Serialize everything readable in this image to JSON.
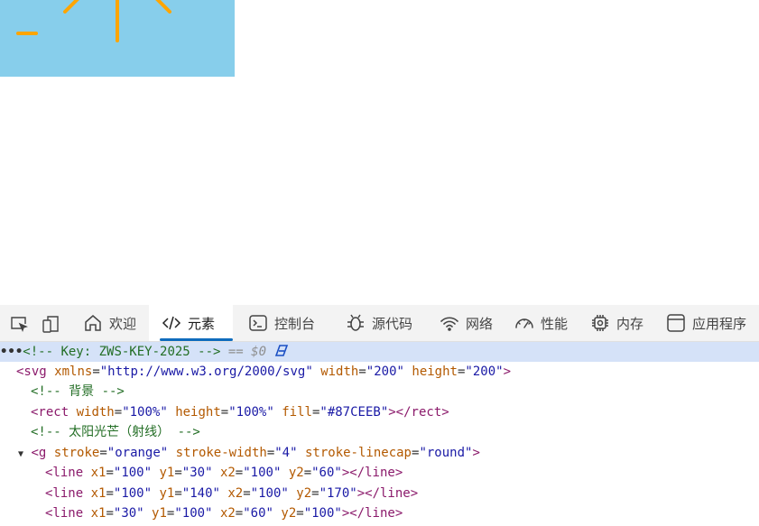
{
  "preview": {
    "background": "#87CEEB",
    "ray_color": "orange"
  },
  "devtools": {
    "tabs": [
      {
        "label": "欢迎",
        "icon": "home-icon"
      },
      {
        "label": "元素",
        "icon": "code-brackets-icon",
        "active": true
      },
      {
        "label": "控制台",
        "icon": "console-icon"
      },
      {
        "label": "源代码",
        "icon": "bug-icon"
      },
      {
        "label": "网络",
        "icon": "wifi-icon"
      },
      {
        "label": "性能",
        "icon": "gauge-icon"
      },
      {
        "label": "内存",
        "icon": "chip-icon"
      },
      {
        "label": "应用程序",
        "icon": "app-window-icon"
      }
    ],
    "code": {
      "l1_ellipsis": "•••",
      "l1_comment": "<!-- Key: ZWS-KEY-2025 -->",
      "l1_eq": " == $0",
      "l2_open": "<svg",
      "l2_a1": "xmlns",
      "l2_v1": "\"http://www.w3.org/2000/svg\"",
      "l2_a2": "width",
      "l2_v2": "\"200\"",
      "l2_a3": "height",
      "l2_v3": "\"200\"",
      "l2_close": ">",
      "l3_comment": "<!-- 背景 -->",
      "l4_open": "<rect",
      "l4_a1": "width",
      "l4_v1": "\"100%\"",
      "l4_a2": "height",
      "l4_v2": "\"100%\"",
      "l4_a3": "fill",
      "l4_v3": "\"#87CEEB\"",
      "l4_close": "></rect>",
      "l5_comment": "<!-- 太阳光芒（射线） -->",
      "l6_triangle": "▼",
      "l6_open": "<g",
      "l6_a1": "stroke",
      "l6_v1": "\"orange\"",
      "l6_a2": "stroke-width",
      "l6_v2": "\"4\"",
      "l6_a3": "stroke-linecap",
      "l6_v3": "\"round\"",
      "l6_close": ">",
      "lines": [
        {
          "x1": "\"100\"",
          "y1": "\"30\"",
          "x2": "\"100\"",
          "y2": "\"60\""
        },
        {
          "x1": "\"100\"",
          "y1": "\"140\"",
          "x2": "\"100\"",
          "y2": "\"170\""
        },
        {
          "x1": "\"30\"",
          "y1": "\"100\"",
          "x2": "\"60\"",
          "y2": "\"100\""
        }
      ],
      "line_open": "<line",
      "line_close": "></line>",
      "eq": "=",
      "attr_x1": "x1",
      "attr_y1": "y1",
      "attr_x2": "x2",
      "attr_y2": "y2"
    }
  }
}
